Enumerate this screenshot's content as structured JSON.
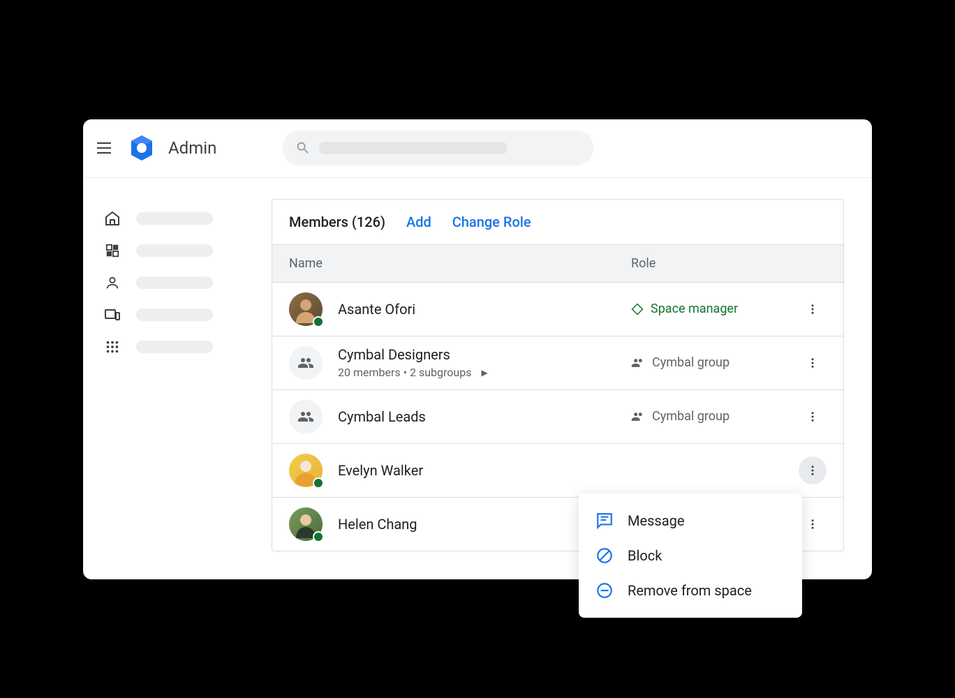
{
  "header": {
    "app_title": "Admin"
  },
  "panel": {
    "title": "Members (126)",
    "add_label": "Add",
    "change_role_label": "Change Role"
  },
  "columns": {
    "name": "Name",
    "role": "Role"
  },
  "members": [
    {
      "name": "Asante Ofori",
      "subtitle": "",
      "role": "Space manager",
      "role_type": "manager",
      "avatar_type": "person1",
      "presence": true
    },
    {
      "name": "Cymbal Designers",
      "subtitle": "20 members  •  2 subgroups",
      "role": "Cymbal group",
      "role_type": "group",
      "avatar_type": "group",
      "presence": false
    },
    {
      "name": "Cymbal Leads",
      "subtitle": "",
      "role": "Cymbal group",
      "role_type": "group",
      "avatar_type": "group",
      "presence": false
    },
    {
      "name": "Evelyn Walker",
      "subtitle": "",
      "role": "",
      "role_type": "",
      "avatar_type": "person2",
      "presence": true
    },
    {
      "name": "Helen Chang",
      "subtitle": "",
      "role": "",
      "role_type": "",
      "avatar_type": "person3",
      "presence": true
    }
  ],
  "popup": {
    "message": "Message",
    "block": "Block",
    "remove": "Remove from space"
  }
}
